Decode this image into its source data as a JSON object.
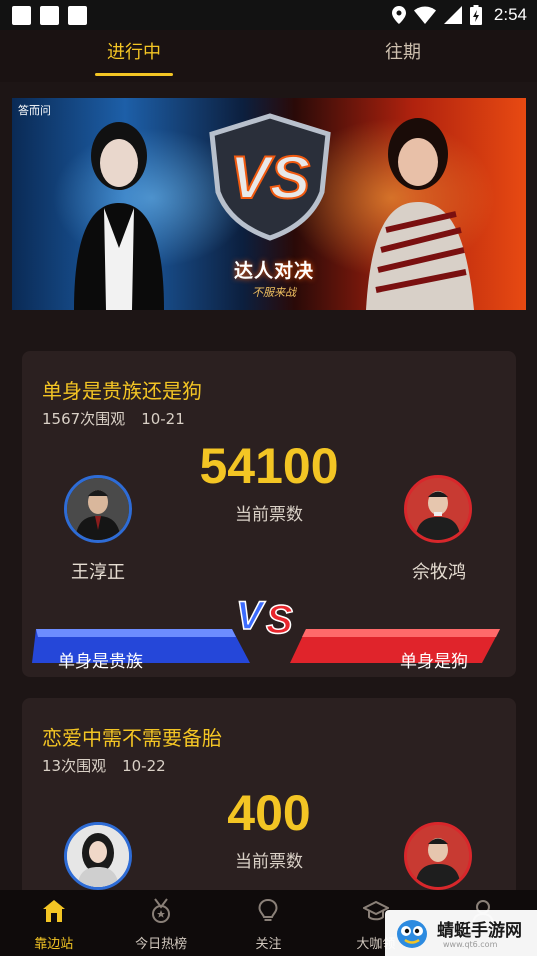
{
  "status_bar": {
    "time": "2:54"
  },
  "tabs": [
    {
      "label": "进行中",
      "active": true
    },
    {
      "label": "往期",
      "active": false
    }
  ],
  "banner": {
    "logo_text": "答而问",
    "title": "达人对决",
    "subtitle": "不服来战"
  },
  "debates": [
    {
      "title": "单身是贵族还是狗",
      "views": "1567次围观",
      "date": "10-21",
      "votes": "54100",
      "votes_label": "当前票数",
      "left_name": "王淳正",
      "right_name": "佘牧鸿",
      "left_side": "单身是贵族",
      "right_side": "单身是狗"
    },
    {
      "title": "恋爱中需不需要备胎",
      "views": "13次围观",
      "date": "10-22",
      "votes": "400",
      "votes_label": "当前票数"
    }
  ],
  "bottom_nav": [
    {
      "label": "靠边站",
      "icon": "home-icon",
      "active": true
    },
    {
      "label": "今日热榜",
      "icon": "medal-icon",
      "active": false
    },
    {
      "label": "关注",
      "icon": "lightbulb-icon",
      "active": false
    },
    {
      "label": "大咖领",
      "icon": "graduation-cap-icon",
      "active": false
    },
    {
      "label": "",
      "icon": "user-icon",
      "active": false
    }
  ],
  "watermark": {
    "text": "蜻蜓手游网",
    "sub": "www.qt6.com"
  },
  "colors": {
    "accent": "#f3c524",
    "blue_side": "#2e6cd6",
    "red_side": "#d8272b",
    "background": "#1d1515",
    "card": "#2b2020"
  }
}
